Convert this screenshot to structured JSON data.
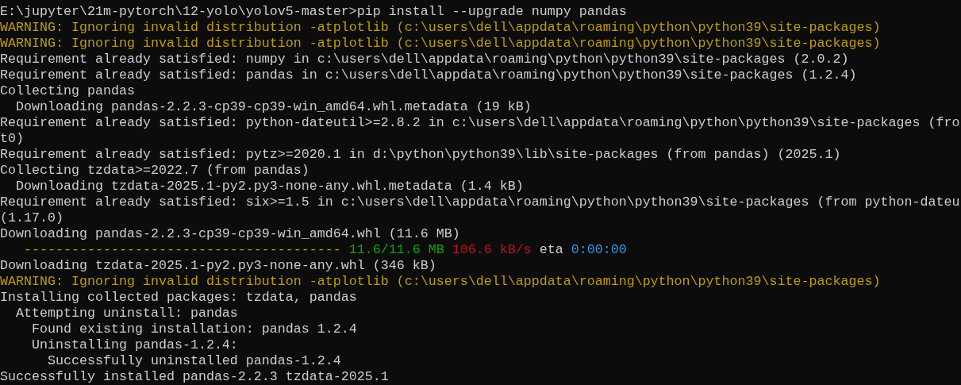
{
  "lines": [
    {
      "segments": [
        {
          "kind": "normal",
          "text": "E:\\jupyter\\21m-pytorch\\12-yolo\\yolov5-master>pip install --upgrade numpy pandas"
        }
      ]
    },
    {
      "segments": [
        {
          "kind": "warning",
          "text": "WARNING: Ignoring invalid distribution -atplotlib (c:\\users\\dell\\appdata\\roaming\\python\\python39\\site-packages)"
        }
      ]
    },
    {
      "segments": [
        {
          "kind": "warning",
          "text": "WARNING: Ignoring invalid distribution -atplotlib (c:\\users\\dell\\appdata\\roaming\\python\\python39\\site-packages)"
        }
      ]
    },
    {
      "segments": [
        {
          "kind": "normal",
          "text": "Requirement already satisfied: numpy in c:\\users\\dell\\appdata\\roaming\\python\\python39\\site-packages (2.0.2)"
        }
      ]
    },
    {
      "segments": [
        {
          "kind": "normal",
          "text": "Requirement already satisfied: pandas in c:\\users\\dell\\appdata\\roaming\\python\\python39\\site-packages (1.2.4)"
        }
      ]
    },
    {
      "segments": [
        {
          "kind": "normal",
          "text": "Collecting pandas"
        }
      ]
    },
    {
      "segments": [
        {
          "kind": "normal",
          "text": "  Downloading pandas-2.2.3-cp39-cp39-win_amd64.whl.metadata (19 kB)"
        }
      ]
    },
    {
      "segments": [
        {
          "kind": "normal",
          "text": "Requirement already satisfied: python-dateutil>=2.8.2 in c:\\users\\dell\\appdata\\roaming\\python\\python39\\site-packages (fro"
        }
      ]
    },
    {
      "segments": [
        {
          "kind": "normal",
          "text": "t0)"
        }
      ]
    },
    {
      "segments": [
        {
          "kind": "normal",
          "text": "Requirement already satisfied: pytz>=2020.1 in d:\\python\\python39\\lib\\site-packages (from pandas) (2025.1)"
        }
      ]
    },
    {
      "segments": [
        {
          "kind": "normal",
          "text": "Collecting tzdata>=2022.7 (from pandas)"
        }
      ]
    },
    {
      "segments": [
        {
          "kind": "normal",
          "text": "  Downloading tzdata-2025.1-py2.py3-none-any.whl.metadata (1.4 kB)"
        }
      ]
    },
    {
      "segments": [
        {
          "kind": "normal",
          "text": "Requirement already satisfied: six>=1.5 in c:\\users\\dell\\appdata\\roaming\\python\\python39\\site-packages (from python-dateu"
        }
      ]
    },
    {
      "segments": [
        {
          "kind": "normal",
          "text": "(1.17.0)"
        }
      ]
    },
    {
      "segments": [
        {
          "kind": "normal",
          "text": "Downloading pandas-2.2.3-cp39-cp39-win_amd64.whl (11.6 MB)"
        }
      ]
    },
    {
      "segments": [
        {
          "kind": "bar",
          "text": "   ----------------------------------------"
        },
        {
          "kind": "size",
          "text": "11.6/11.6 MB"
        },
        {
          "kind": "speed",
          "text": "106.6 kB/s"
        },
        {
          "kind": "normal",
          "text": "eta"
        },
        {
          "kind": "eta",
          "text": "0:00:00"
        }
      ]
    },
    {
      "segments": [
        {
          "kind": "normal",
          "text": "Downloading tzdata-2025.1-py2.py3-none-any.whl (346 kB)"
        }
      ]
    },
    {
      "segments": [
        {
          "kind": "warning",
          "text": "WARNING: Ignoring invalid distribution -atplotlib (c:\\users\\dell\\appdata\\roaming\\python\\python39\\site-packages)"
        }
      ]
    },
    {
      "segments": [
        {
          "kind": "normal",
          "text": "Installing collected packages: tzdata, pandas"
        }
      ]
    },
    {
      "segments": [
        {
          "kind": "normal",
          "text": "  Attempting uninstall: pandas"
        }
      ]
    },
    {
      "segments": [
        {
          "kind": "normal",
          "text": "    Found existing installation: pandas 1.2.4"
        }
      ]
    },
    {
      "segments": [
        {
          "kind": "normal",
          "text": "    Uninstalling pandas-1.2.4:"
        }
      ]
    },
    {
      "segments": [
        {
          "kind": "normal",
          "text": "      Successfully uninstalled pandas-1.2.4"
        }
      ]
    },
    {
      "segments": [
        {
          "kind": "normal",
          "text": "Successfully installed pandas-2.2.3 tzdata-2025.1"
        }
      ]
    }
  ]
}
